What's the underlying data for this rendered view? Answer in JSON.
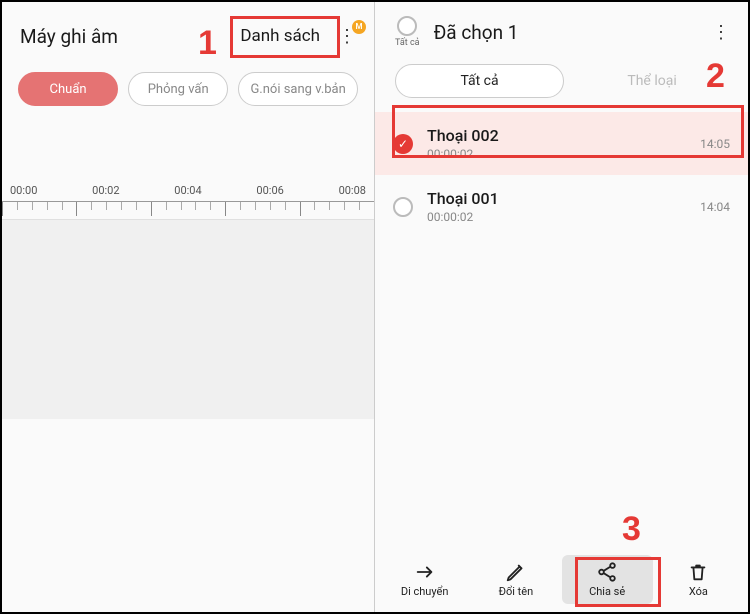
{
  "left": {
    "title": "Máy ghi âm",
    "list_label": "Danh sách",
    "badge": "M",
    "modes": {
      "standard": "Chuẩn",
      "interview": "Phỏng vấn",
      "convert": "G.nói sang v.bản"
    },
    "timeline": [
      "00:00",
      "00:02",
      "00:04",
      "00:06",
      "00:08"
    ]
  },
  "right": {
    "select_all": "Tất cả",
    "selected_title": "Đã chọn 1",
    "filter_all": "Tất cả",
    "filter_category": "Thể loại",
    "recordings": [
      {
        "name": "Thoại 002",
        "duration": "00:00:02",
        "time": "14:05",
        "selected": true
      },
      {
        "name": "Thoại 001",
        "duration": "00:00:02",
        "time": "14:04",
        "selected": false
      }
    ],
    "actions": {
      "move": "Di chuyển",
      "rename": "Đổi tên",
      "share": "Chia sẻ",
      "delete": "Xóa"
    }
  },
  "annotations": {
    "n1": "1",
    "n2": "2",
    "n3": "3"
  }
}
